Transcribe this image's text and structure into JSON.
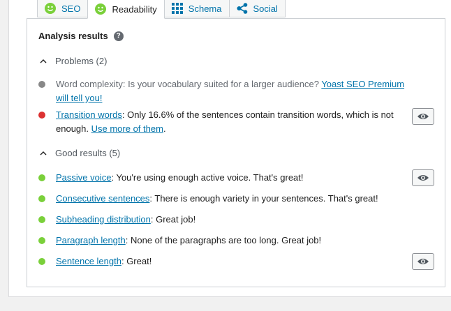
{
  "tabs": [
    {
      "label": "SEO",
      "icon": "smiley-icon"
    },
    {
      "label": "Readability",
      "icon": "smiley-icon"
    },
    {
      "label": "Schema",
      "icon": "grid-icon"
    },
    {
      "label": "Social",
      "icon": "share-icon"
    }
  ],
  "title": "Analysis results",
  "help_glyph": "?",
  "colors": {
    "good": "#7ad03a",
    "bad": "#dc3232",
    "neutral": "#888888",
    "link": "#0073aa"
  },
  "problems": {
    "label": "Problems (2)",
    "items": [
      {
        "status": "neutral",
        "text": "Word complexity: Is your vocabulary suited for a larger audience? ",
        "link": "Yoast SEO Premium will tell you!"
      },
      {
        "status": "bad",
        "link": "Transition words",
        "text": ": Only 16.6% of the sentences contain transition words, which is not enough. ",
        "link2": "Use more of them",
        "tail": "."
      }
    ]
  },
  "good": {
    "label": "Good results (5)",
    "items": [
      {
        "link": "Passive voice",
        "text": ": You're using enough active voice. That's great!"
      },
      {
        "link": "Consecutive sentences",
        "text": ": There is enough variety in your sentences. That's great!"
      },
      {
        "link": "Subheading distribution",
        "text": ": Great job!"
      },
      {
        "link": "Paragraph length",
        "text": ": None of the paragraphs are too long. Great job!"
      },
      {
        "link": "Sentence length",
        "text": ": Great!"
      }
    ]
  }
}
